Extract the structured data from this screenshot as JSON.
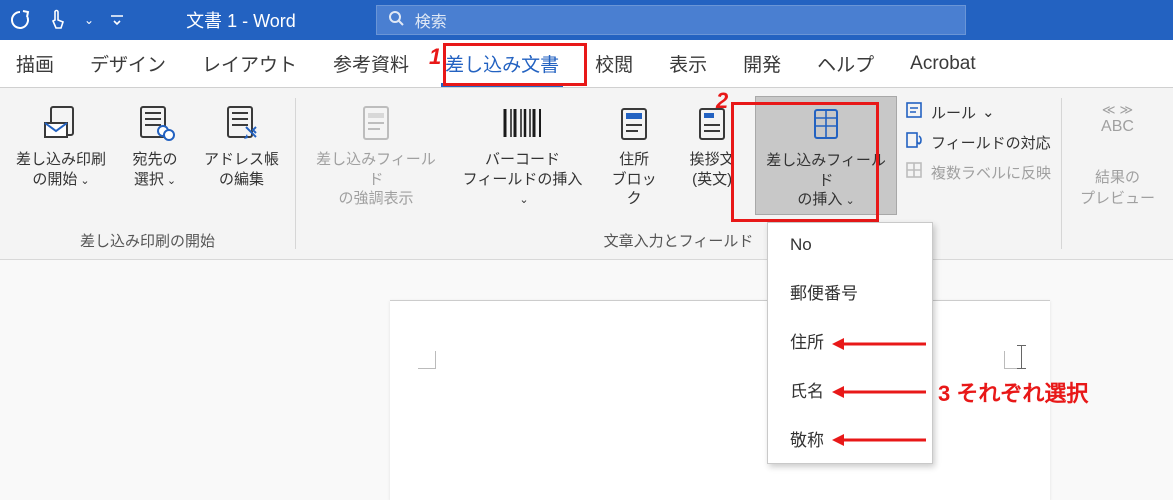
{
  "titlebar": {
    "title": "文書 1  -  Word",
    "search_placeholder": "検索"
  },
  "tabs": {
    "draw": "描画",
    "design": "デザイン",
    "layout": "レイアウト",
    "references": "参考資料",
    "mailings": "差し込み文書",
    "review": "校閲",
    "view": "表示",
    "developer": "開発",
    "help": "ヘルプ",
    "acrobat": "Acrobat"
  },
  "ribbon": {
    "group1": {
      "start": {
        "l1": "差し込み印刷",
        "l2": "の開始"
      },
      "recipients": {
        "l1": "宛先の",
        "l2": "選択"
      },
      "edit": {
        "l1": "アドレス帳",
        "l2": "の編集"
      },
      "label": "差し込み印刷の開始"
    },
    "group2": {
      "highlight": {
        "l1": "差し込みフィールド",
        "l2": "の強調表示"
      },
      "barcode": {
        "l1": "バーコード",
        "l2": "フィールドの挿入"
      },
      "address": {
        "l1": "住所",
        "l2": "ブロック"
      },
      "greeting": {
        "l1": "挨拶文",
        "l2": "(英文)"
      },
      "insert_field": {
        "l1": "差し込みフィールド",
        "l2": "の挿入"
      },
      "rules": "ルール",
      "match": "フィールドの対応",
      "update": "複数ラベルに反映",
      "label": "文章入力とフィールド"
    },
    "group3": {
      "abc": "ABC",
      "preview": {
        "l1": "結果の",
        "l2": "プレビュー"
      }
    }
  },
  "dropdown": {
    "items": [
      "No",
      "郵便番号",
      "住所",
      "氏名",
      "敬称"
    ]
  },
  "callouts": {
    "n1": "1",
    "n2": "2",
    "n3": "3 それぞれ選択"
  }
}
